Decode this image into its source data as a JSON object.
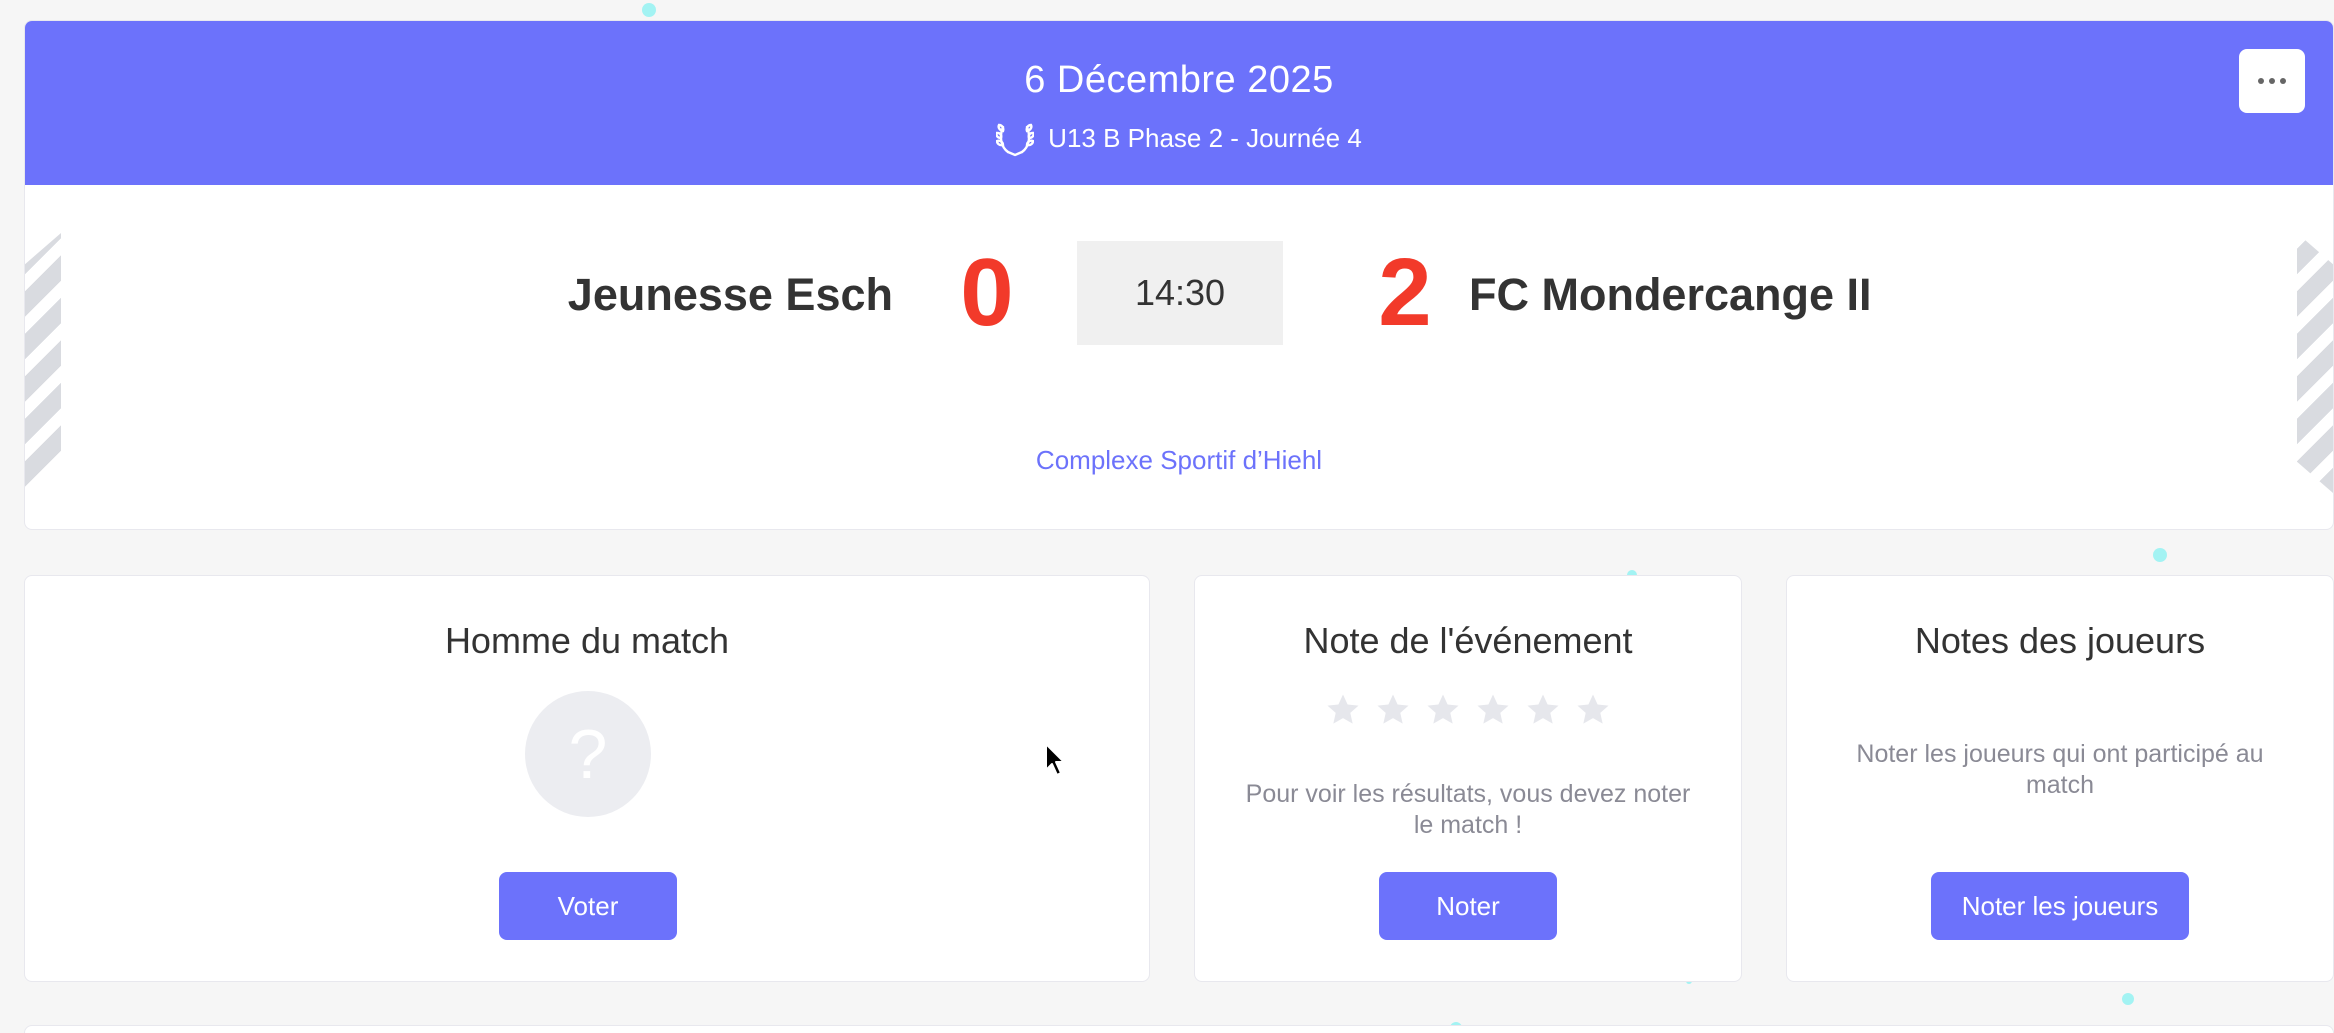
{
  "match": {
    "date": "6 Décembre 2025",
    "competition": "U13 B Phase 2 - Journée 4",
    "home_team": "Jeunesse Esch",
    "away_team": "FC Mondercange II",
    "home_score": "0",
    "away_score": "2",
    "kickoff_time": "14:30",
    "venue": "Complexe Sportif d’Hiehl",
    "menu_icon": "more-horizontal-icon",
    "competition_icon": "laurel-icon"
  },
  "man_of_match": {
    "title": "Homme du match",
    "placeholder": "?",
    "button": "Voter"
  },
  "event_rating": {
    "title": "Note de l'événement",
    "stars": 6,
    "rating": 0,
    "message": "Pour voir les résultats, vous devez noter le match !",
    "button": "Noter"
  },
  "player_ratings": {
    "title": "Notes des joueurs",
    "message": "Noter les joueurs qui ont participé au match",
    "button": "Noter les joueurs"
  },
  "colors": {
    "accent": "#6c72fb",
    "score": "#f23a2a",
    "star_empty": "#e6e7ec",
    "background": "#f6f6f6"
  }
}
